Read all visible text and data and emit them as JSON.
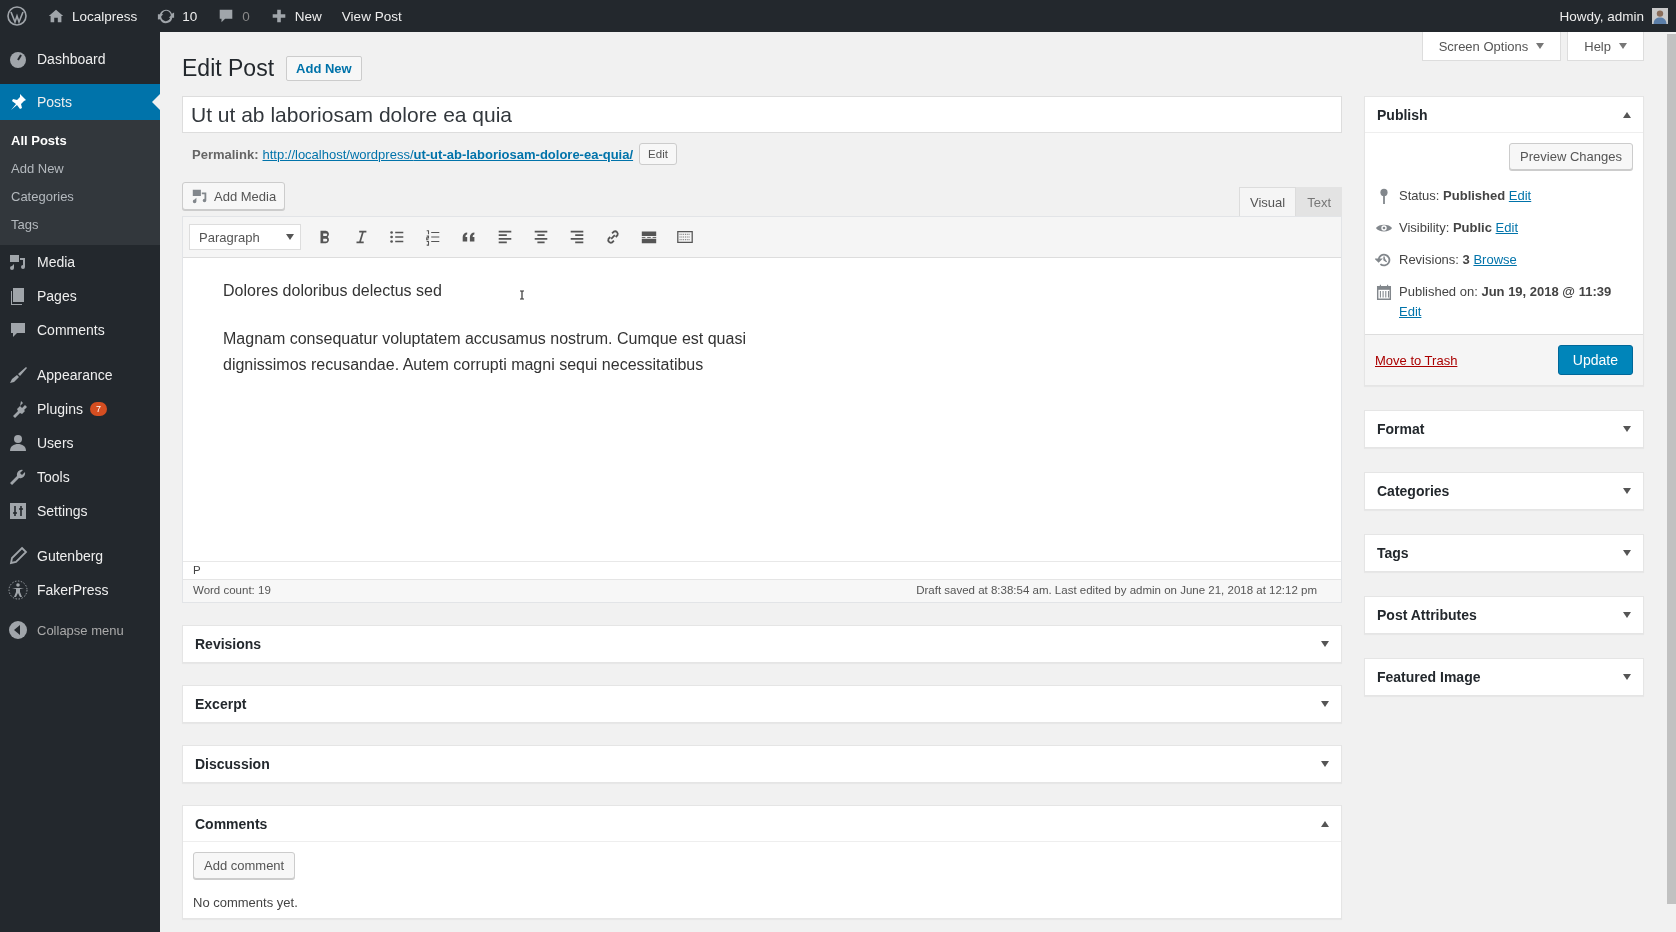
{
  "admin_bar": {
    "site": "Localpress",
    "updates": "10",
    "comments": "0",
    "new": "New",
    "view": "View Post",
    "greeting": "Howdy, admin"
  },
  "sidebar": {
    "groups": [
      [
        {
          "label": "Dashboard",
          "selected": false
        },
        {
          "label": "Posts",
          "selected": true,
          "children": [
            {
              "label": "All Posts",
              "selected": true
            },
            {
              "label": "Add New",
              "selected": false
            },
            {
              "label": "Categories",
              "selected": false
            },
            {
              "label": "Tags",
              "selected": false
            }
          ]
        },
        {
          "label": "Media",
          "selected": false
        },
        {
          "label": "Pages",
          "selected": false
        },
        {
          "label": "Comments",
          "selected": false
        }
      ],
      [
        {
          "label": "Appearance",
          "selected": false
        },
        {
          "label": "Plugins",
          "selected": false,
          "badge": "7"
        },
        {
          "label": "Users",
          "selected": false
        },
        {
          "label": "Tools",
          "selected": false
        },
        {
          "label": "Settings",
          "selected": false
        }
      ],
      [
        {
          "label": "Gutenberg",
          "selected": false
        },
        {
          "label": "FakerPress",
          "selected": false
        }
      ]
    ],
    "collapse": "Collapse menu"
  },
  "screen_options": "Screen Options",
  "help": "Help",
  "heading": "Edit Post",
  "add_new": "Add New",
  "editor": {
    "title": "Ut ut ab laboriosam dolore ea quia",
    "permalink_label": "Permalink:",
    "url_base": "http://localhost/wordpress/",
    "slug": "ut-ut-ab-laboriosam-dolore-ea-quia/",
    "permalink_edit": "Edit",
    "add_media": "Add Media",
    "tabs": [
      {
        "label": "Visual",
        "selected": true
      },
      {
        "label": "Text",
        "selected": false
      }
    ],
    "format": "Paragraph",
    "paragraphs": [
      "Dolores doloribus delectus sed",
      "Magnam consequatur voluptatem accusamus nostrum. Cumque est quasi dignissimos recusandae. Autem corrupti magni sequi necessitatibus"
    ],
    "path": "P",
    "word_count": "Word count: 19",
    "draft_status": "Draft saved at 8:38:54 am. Last edited by admin on June 21, 2018 at 12:12 pm"
  },
  "boxes": [
    {
      "title": "Revisions",
      "expanded": false
    },
    {
      "title": "Excerpt",
      "expanded": false
    },
    {
      "title": "Discussion",
      "expanded": false
    },
    {
      "title": "Comments",
      "expanded": true,
      "button": "Add comment",
      "text": "No comments yet."
    }
  ],
  "publish": {
    "title": "Publish",
    "expanded": true,
    "preview": "Preview Changes",
    "rows": [
      {
        "label": "Status:",
        "value": "Published",
        "link": "Edit"
      },
      {
        "label": "Visibility:",
        "value": "Public",
        "link": "Edit"
      },
      {
        "label": "Revisions:",
        "value": "3",
        "link": "Browse"
      },
      {
        "label": "Published on:",
        "value": "Jun 19, 2018 @ 11:39",
        "link": "Edit"
      }
    ],
    "trash": "Move to Trash",
    "update": "Update"
  },
  "side_boxes": [
    {
      "title": "Format",
      "expanded": false
    },
    {
      "title": "Categories",
      "expanded": false
    },
    {
      "title": "Tags",
      "expanded": false
    },
    {
      "title": "Post Attributes",
      "expanded": false
    },
    {
      "title": "Featured Image",
      "expanded": false
    }
  ]
}
